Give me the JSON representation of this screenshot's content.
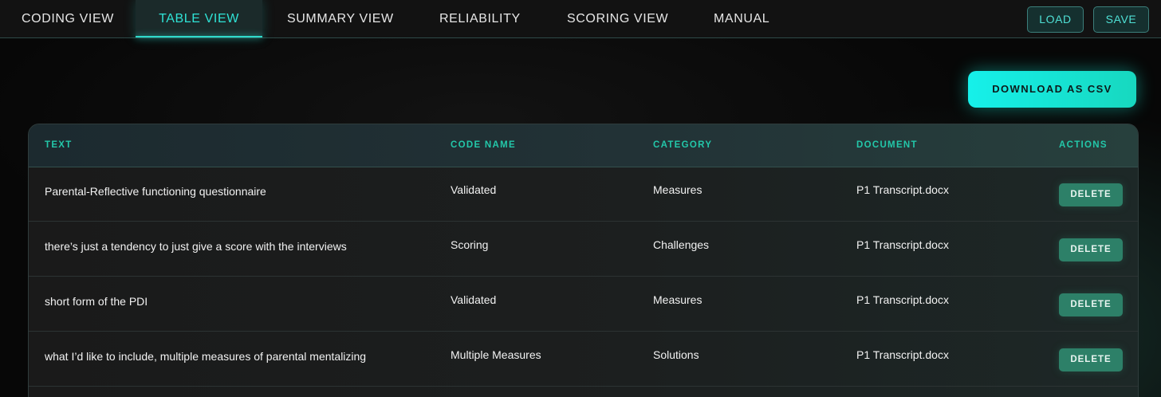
{
  "nav": {
    "tabs": [
      {
        "label": "CODING VIEW"
      },
      {
        "label": "TABLE VIEW"
      },
      {
        "label": "SUMMARY VIEW"
      },
      {
        "label": "RELIABILITY"
      },
      {
        "label": "SCORING VIEW"
      },
      {
        "label": "MANUAL"
      }
    ],
    "active_tab": "TABLE VIEW",
    "load_label": "LOAD",
    "save_label": "SAVE"
  },
  "download_label": "DOWNLOAD AS CSV",
  "table": {
    "headers": {
      "text": "TEXT",
      "code_name": "CODE NAME",
      "category": "CATEGORY",
      "document": "DOCUMENT",
      "actions": "ACTIONS"
    },
    "rows": [
      {
        "text": "Parental-Reflective functioning questionnaire",
        "code_name": "Validated",
        "category": "Measures",
        "document": "P1 Transcript.docx",
        "action": "DELETE"
      },
      {
        "text": "there’s just a tendency to just give a score with the interviews",
        "code_name": "Scoring",
        "category": "Challenges",
        "document": "P1 Transcript.docx",
        "action": "DELETE"
      },
      {
        "text": "short form of the PDI",
        "code_name": "Validated",
        "category": "Measures",
        "document": "P1 Transcript.docx",
        "action": "DELETE"
      },
      {
        "text": "what I’d like to include, multiple measures of parental mentalizing",
        "code_name": "Multiple Measures",
        "category": "Solutions",
        "document": "P1 Transcript.docx",
        "action": "DELETE"
      }
    ]
  },
  "colors": {
    "accent": "#2fe3d6",
    "header_text": "#23c7a9",
    "delete_button": "#2d8068",
    "download_button": "#16f0ea"
  }
}
